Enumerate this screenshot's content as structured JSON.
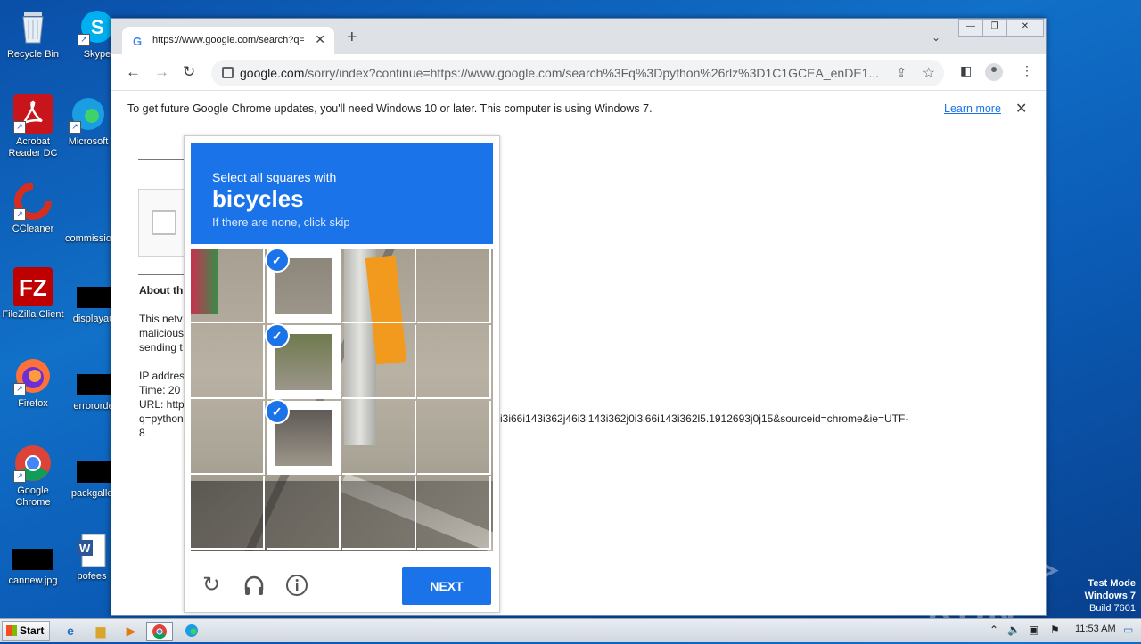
{
  "desktop": {
    "icons_left": [
      {
        "label": "Recycle Bin",
        "icon": "recycle-bin-icon"
      },
      {
        "label": "Acrobat Reader DC",
        "icon": "acrobat-icon"
      },
      {
        "label": "CCleaner",
        "icon": "ccleaner-icon"
      },
      {
        "label": "FileZilla Client",
        "icon": "filezilla-icon"
      },
      {
        "label": "Firefox",
        "icon": "firefox-icon"
      },
      {
        "label": "Google Chrome",
        "icon": "chrome-icon"
      },
      {
        "label": "cannew.jpg",
        "icon": "image-file-icon"
      }
    ],
    "icons_right": [
      {
        "label": "Skype",
        "icon": "skype-icon"
      },
      {
        "label": "Microsoft",
        "icon": "edge-icon"
      },
      {
        "label": "commissio",
        "icon": "file-icon"
      },
      {
        "label": "displayau",
        "icon": "file-icon"
      },
      {
        "label": "errororde",
        "icon": "file-icon"
      },
      {
        "label": "packgaller",
        "icon": "file-icon"
      },
      {
        "label": "pofees",
        "icon": "word-icon"
      }
    ]
  },
  "browser": {
    "tab_title": "https://www.google.com/search?q=",
    "new_tab": "+",
    "url_host": "google.com",
    "url_rest": "/sorry/index?continue=https://www.google.com/search%3Fq%3Dpython%26rlz%3D1C1GCEA_enDE1...",
    "infobar_message": "To get future Google Chrome updates, you'll need Windows 10 or later. This computer is using Windows 7.",
    "infobar_link": "Learn more"
  },
  "page": {
    "about_heading": "About th",
    "para_lines": [
      "This netv",
      "malicious",
      "sending t"
    ],
    "ip_line": "IP addres",
    "time_line": "Time: 20",
    "url_line": "URL: http",
    "q_line": "q=python",
    "q_tail": "i3i66i143i362j46i3i143i362j0i3i66i143i362l5.1912693j0j15&sourceid=chrome&ie=UTF-",
    "eight": "8"
  },
  "captcha": {
    "instruction": "Select all squares with",
    "target": "bicycles",
    "hint": "If there are none, click skip",
    "selected_tiles": [
      1,
      5,
      9
    ],
    "next_label": "NEXT",
    "check_glyph": "✓"
  },
  "watermark": {
    "brand": "ANY ▷ RUN",
    "line1": "Test Mode",
    "line2": "Windows 7",
    "line3": "Build 7601"
  },
  "taskbar": {
    "start_label": "Start",
    "clock": "11:53 AM"
  },
  "colors": {
    "accent": "#1a73e8",
    "desktop": "#0b5cb6"
  }
}
